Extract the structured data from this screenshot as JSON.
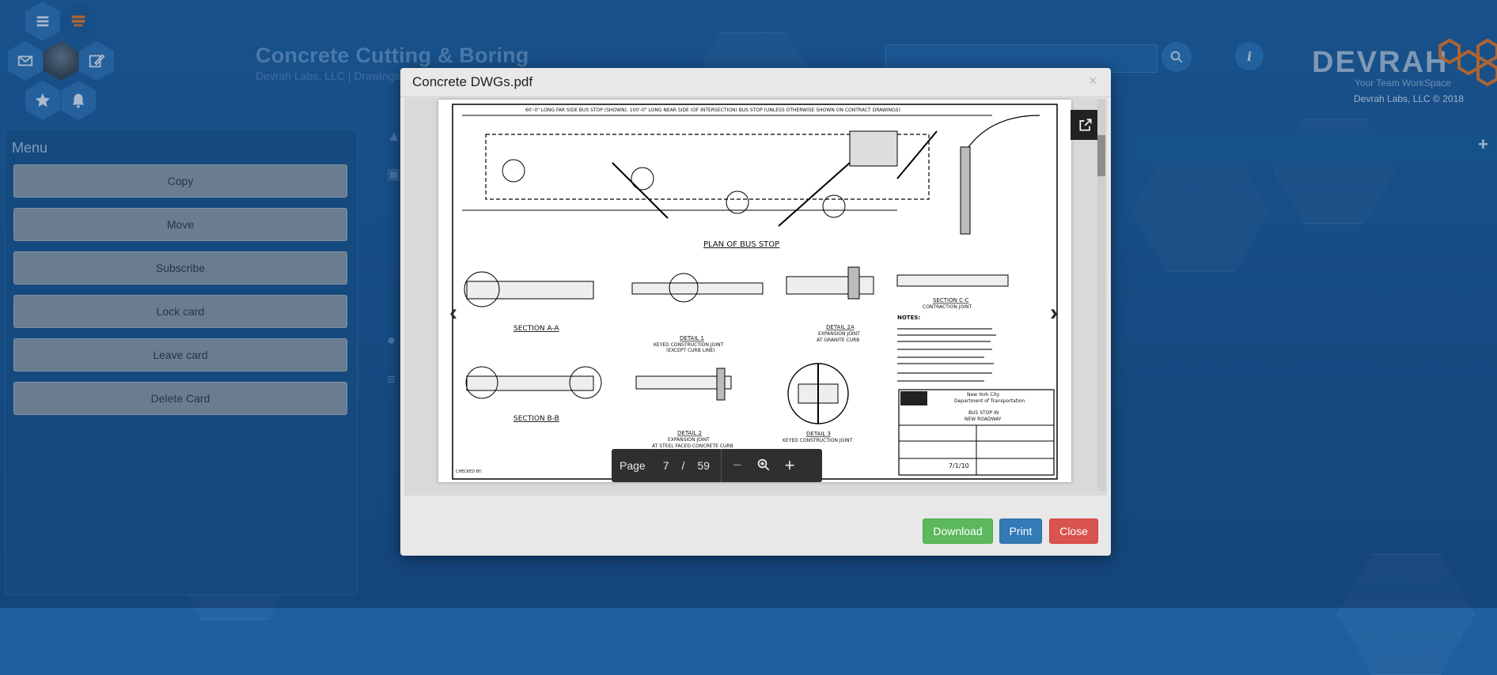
{
  "header": {
    "title": "Concrete Cutting & Boring",
    "subtitle": "Devrah Labs, LLC | Drawings",
    "search_placeholder": "",
    "logo_text": "DEVRAH",
    "tagline": "Your Team WorkSpace",
    "copyright": "Devrah Labs, LLC © 2018"
  },
  "nav_icons": [
    "list-icon",
    "stack-icon",
    "mail-icon",
    "avatar",
    "edit-icon",
    "star-icon",
    "bell-icon"
  ],
  "menu": {
    "title": "Menu",
    "items": [
      "Copy",
      "Move",
      "Subscribe",
      "Lock card",
      "Leave card",
      "Delete Card"
    ]
  },
  "modal": {
    "title": "Concrete DWGs.pdf",
    "close_x": "×",
    "page_label": "Page",
    "current_page": "7",
    "separator": "/",
    "total_pages": "59",
    "buttons": {
      "download": "Download",
      "print": "Print",
      "close": "Close"
    }
  },
  "drawing": {
    "top_note": "60'-0\" LONG FAR SIDE BUS STOP (SHOWN), 100'-0\" LONG NEAR SIDE (OF INTERSECTION) BUS STOP (UNLESS OTHERWISE SHOWN ON CONTRACT DRAWINGS)",
    "plan_title": "PLAN OF BUS STOP",
    "section_aa": "SECTION A-A",
    "section_bb": "SECTION B-B",
    "section_cc": "SECTION C-C",
    "section_cc_sub": "CONTRACTION JOINT",
    "detail1": "DETAIL 1",
    "detail1_sub": "KEYED CONSTRUCTION JOINT",
    "detail1_sub2": "(EXCEPT CURB LINE)",
    "detail2": "DETAIL 2",
    "detail2_sub": "EXPANSION JOINT",
    "detail2_sub2": "AT STEEL FACED CONCRETE CURB",
    "detail2a": "DETAIL 2A",
    "detail2a_sub": "EXPANSION JOINT",
    "detail2a_sub2": "AT GRANITE CURB",
    "detail3": "DETAIL 3",
    "detail3_sub": "KEYED CONSTRUCTION JOINT",
    "notes_title": "NOTES:",
    "agency": "New York City",
    "agency2": "Department of Transportation",
    "sheet_title": "BUS STOP IN",
    "sheet_title2": "NEW ROADWAY",
    "date": "7/1/10",
    "checked_by": "CHECKED BY:"
  }
}
